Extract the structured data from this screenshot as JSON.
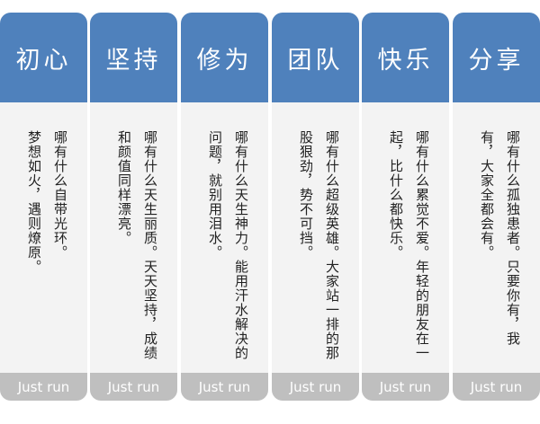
{
  "cards": [
    {
      "title": "初心",
      "lines": [
        "哪有什么自带光环。",
        "梦想如火，遇则燎原。"
      ],
      "footer": "Just run"
    },
    {
      "title": "坚持",
      "lines": [
        "哪有什么天生丽质。天天坚持，成绩",
        "和颜值同样漂亮。"
      ],
      "footer": "Just run"
    },
    {
      "title": "修为",
      "lines": [
        "哪有什么天生神力。能用汗水解决的",
        "问题，就别用泪水。"
      ],
      "footer": "Just run"
    },
    {
      "title": "团队",
      "lines": [
        "哪有什么超级英雄。大家站一排的那",
        "股狠劲，势不可挡。"
      ],
      "footer": "Just run"
    },
    {
      "title": "快乐",
      "lines": [
        "哪有什么累觉不爱。年轻的朋友在一",
        "起，比什么都快乐。"
      ],
      "footer": "Just run"
    },
    {
      "title": "分享",
      "lines": [
        "哪有什么孤独患者。只要你有，我",
        "有，大家全都会有。"
      ],
      "footer": "Just run"
    }
  ]
}
